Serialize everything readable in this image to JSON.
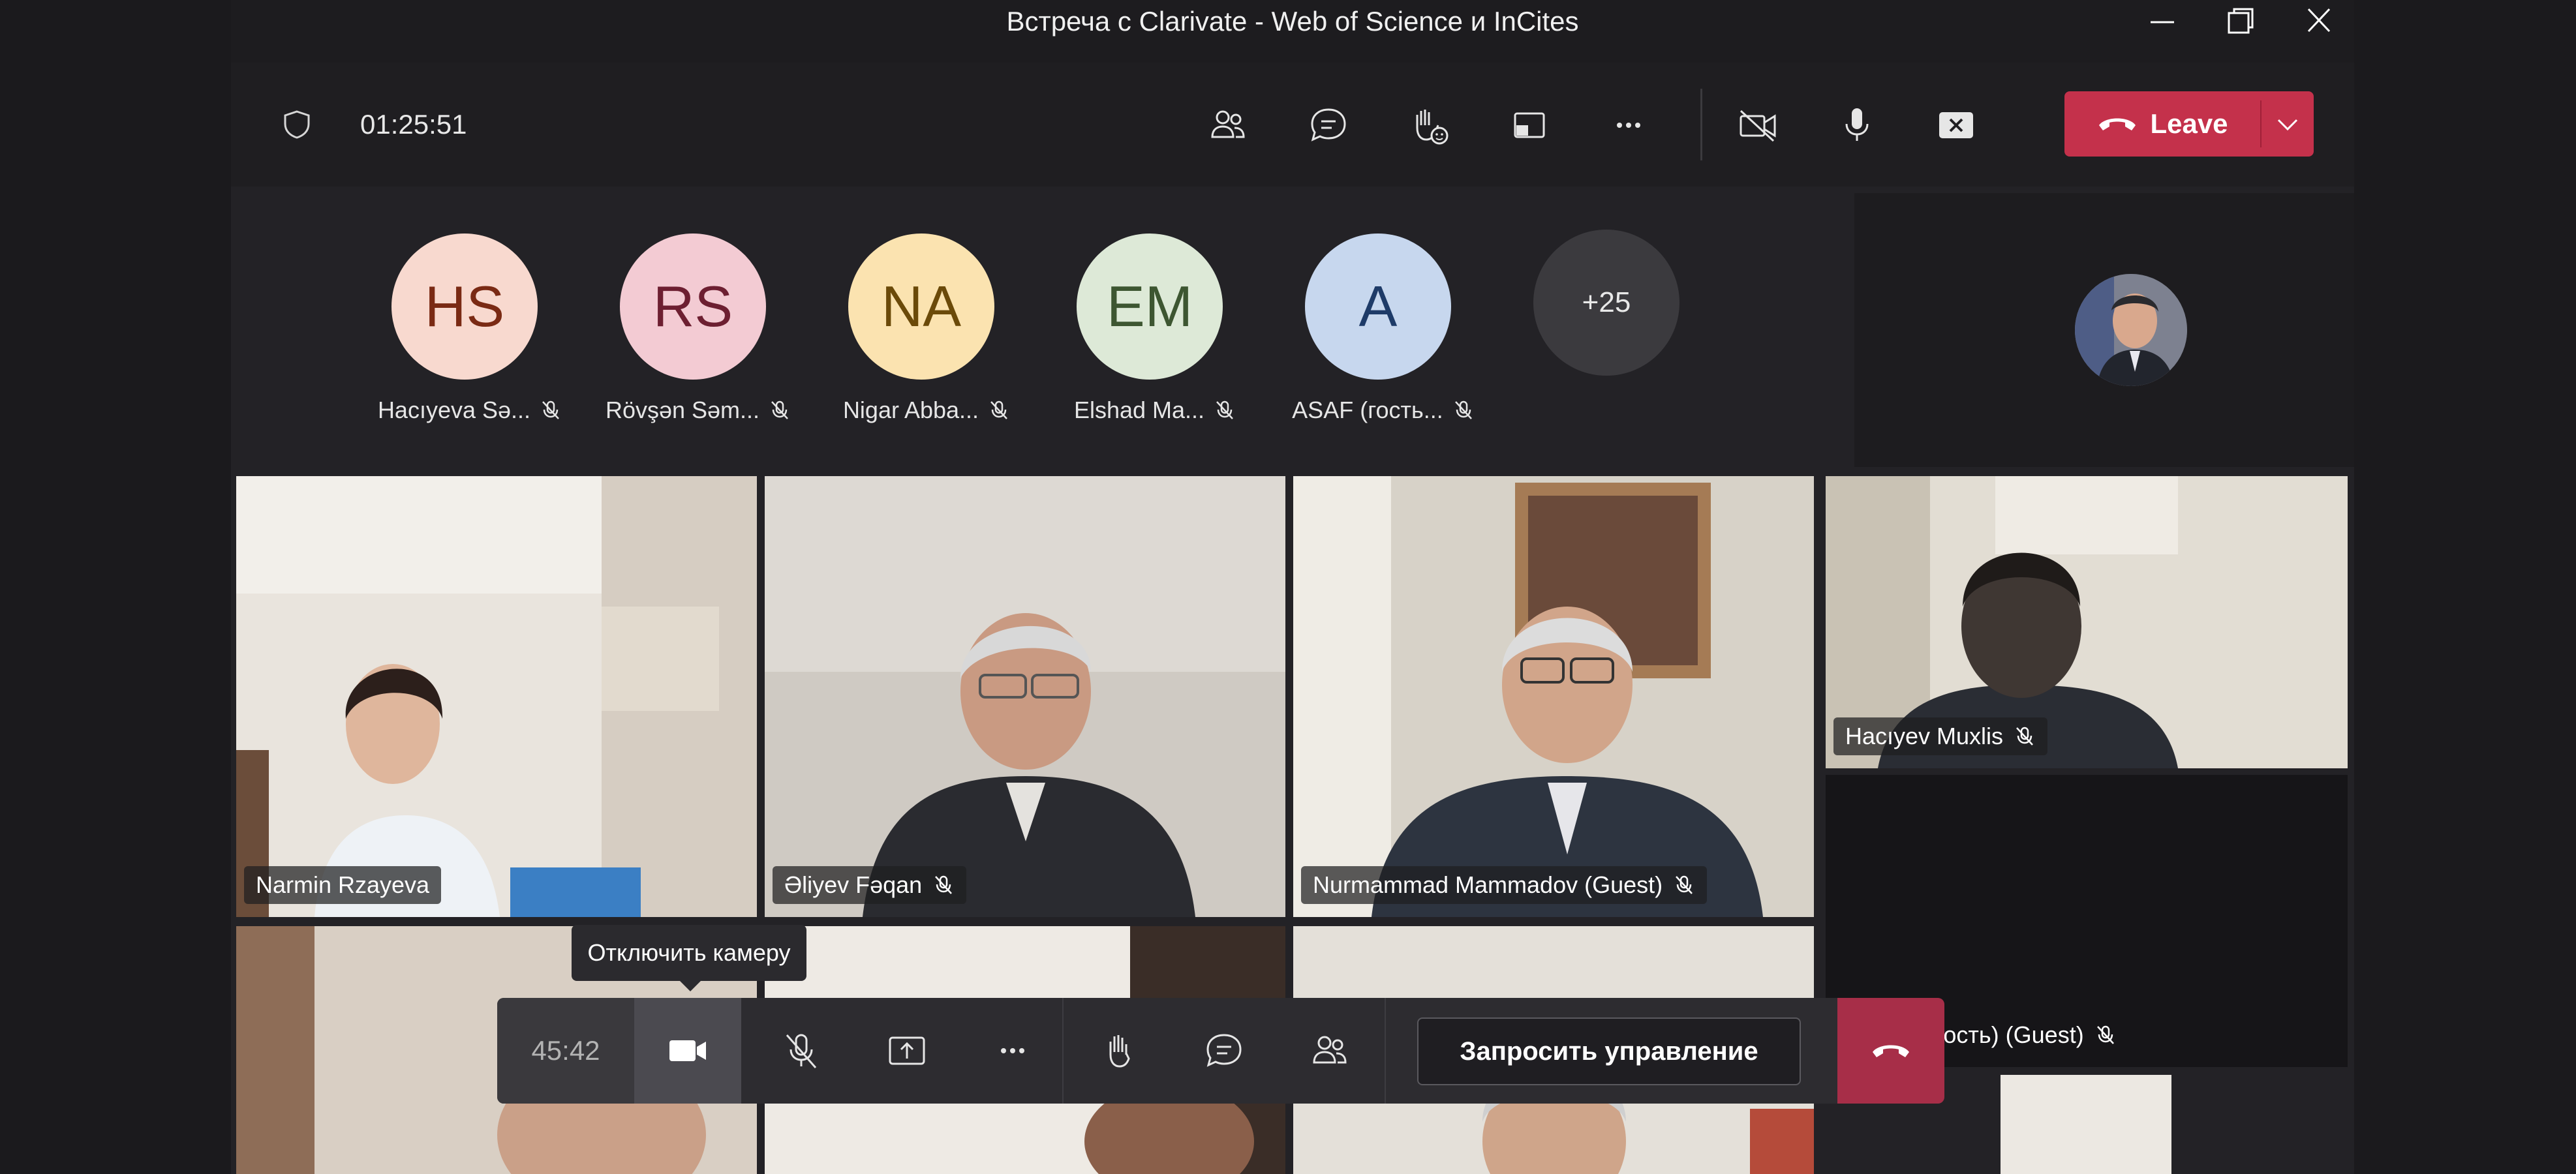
{
  "window": {
    "title": "Встреча с Clarivate - Web of Science и InCites"
  },
  "toolbar": {
    "timer": "01:25:51",
    "leave_label": "Leave"
  },
  "roster": [
    {
      "initials": "HS",
      "name": "Hacıyeva Sə...",
      "bg": "#f8d9cf",
      "fg": "#7a2a14"
    },
    {
      "initials": "RS",
      "name": "Rövşən Səm...",
      "bg": "#f3cbd3",
      "fg": "#6d1f31"
    },
    {
      "initials": "NA",
      "name": "Nigar Abba...",
      "bg": "#fbe3b0",
      "fg": "#6b4a09"
    },
    {
      "initials": "EM",
      "name": "Elshad Ma...",
      "bg": "#dde9d7",
      "fg": "#3d5631"
    },
    {
      "initials": "A",
      "name": "ASAF (гость...",
      "bg": "#c7d7ee",
      "fg": "#1e3b68"
    }
  ],
  "more_count": "+25",
  "tiles": {
    "narmin": "Narmin Rzayeva",
    "aliyev": "Əliyev Fəqan",
    "nurmammad": "Nurmammad Mammadov (Guest)",
    "haciyev": "Hacıyev Muxlis",
    "yusifov": "Yusifov (гость) (Guest)"
  },
  "minibar": {
    "time": "45:42",
    "request_control": "Запросить управление",
    "tooltip": "Отключить камеру"
  },
  "colors": {
    "leave_red": "#c4314b",
    "hang_red": "#a72e48",
    "accent": "#6264a7"
  }
}
